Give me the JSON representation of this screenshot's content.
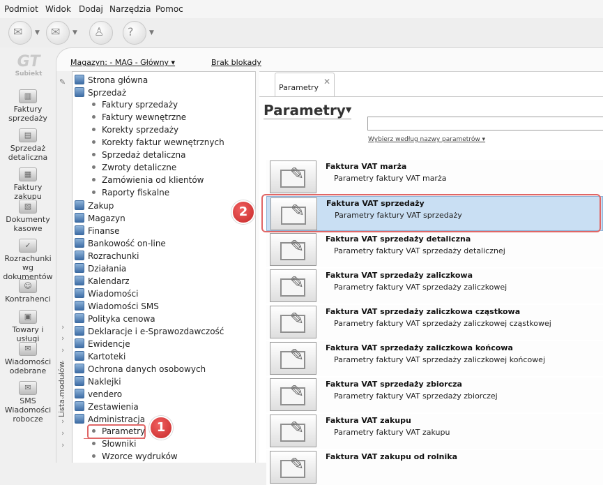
{
  "menu": [
    "Podmiot",
    "Widok",
    "Dodaj",
    "Narzędzia",
    "Pomoc"
  ],
  "toolbar": {
    "icons": [
      "send-icon",
      "mail-icon",
      "stamp-icon",
      "help-icon"
    ]
  },
  "leftnav": {
    "logo_text": "Subiekt",
    "items": [
      {
        "label": "Faktury sprzedaży",
        "icon": "coins-icon"
      },
      {
        "label": "Sprzedaż detaliczna",
        "icon": "bag-icon"
      },
      {
        "label": "Faktury zakupu",
        "icon": "documents-icon"
      },
      {
        "label": "Dokumenty kasowe",
        "icon": "cash-icon"
      },
      {
        "label": "Rozrachunki wg dokumentów",
        "icon": "check-icon"
      },
      {
        "label": "Kontrahenci",
        "icon": "person-icon"
      },
      {
        "label": "Towary i usługi",
        "icon": "box-icon"
      },
      {
        "label": "Wiadomości odebrane",
        "icon": "inbox-icon"
      },
      {
        "label": "SMS Wiadomości robocze",
        "icon": "sms-icon"
      }
    ]
  },
  "header": {
    "magazyn": "Magazyn: - MAG - Główny ▾",
    "blokada": "Brak blokady"
  },
  "module_strip_label": "Lista modułów",
  "tree": {
    "items": [
      {
        "label": "Strona główna",
        "level": 0
      },
      {
        "label": "Sprzedaż",
        "level": 0
      },
      {
        "label": "Faktury sprzedaży",
        "level": 1
      },
      {
        "label": "Faktury wewnętrzne",
        "level": 1
      },
      {
        "label": "Korekty sprzedaży",
        "level": 1
      },
      {
        "label": "Korekty faktur wewnętrznych",
        "level": 1
      },
      {
        "label": "Sprzedaż detaliczna",
        "level": 1
      },
      {
        "label": "Zwroty detaliczne",
        "level": 1
      },
      {
        "label": "Zamówienia od klientów",
        "level": 1
      },
      {
        "label": "Raporty fiskalne",
        "level": 1
      },
      {
        "label": "Zakup",
        "level": 0
      },
      {
        "label": "Magazyn",
        "level": 0
      },
      {
        "label": "Finanse",
        "level": 0
      },
      {
        "label": "Bankowość on-line",
        "level": 0
      },
      {
        "label": "Rozrachunki",
        "level": 0
      },
      {
        "label": "Działania",
        "level": 0
      },
      {
        "label": "Kalendarz",
        "level": 0
      },
      {
        "label": "Wiadomości",
        "level": 0
      },
      {
        "label": "Wiadomości SMS",
        "level": 0
      },
      {
        "label": "Polityka cenowa",
        "level": 0
      },
      {
        "label": "Deklaracje i e-Sprawozdawczość",
        "level": 0
      },
      {
        "label": "Ewidencje",
        "level": 0
      },
      {
        "label": "Kartoteki",
        "level": 0
      },
      {
        "label": "Ochrona danych osobowych",
        "level": 0
      },
      {
        "label": "Naklejki",
        "level": 0
      },
      {
        "label": "vendero",
        "level": 0
      },
      {
        "label": "Zestawienia",
        "level": 0
      },
      {
        "label": "Administracja",
        "level": 0
      },
      {
        "label": "Parametry",
        "level": 1,
        "selected": true
      },
      {
        "label": "Słowniki",
        "level": 1
      },
      {
        "label": "Wzorce wydruków",
        "level": 1
      }
    ]
  },
  "tab": {
    "label": "Parametry",
    "close": "✕"
  },
  "page": {
    "title": "Parametry",
    "search_value": "",
    "search_hint": "Wybierz według nazwy parametrów ▾"
  },
  "params": [
    {
      "title": "Faktura VAT marża",
      "desc": "Parametry faktury VAT marża"
    },
    {
      "title": "Faktura VAT sprzedaży",
      "desc": "Parametry faktury VAT sprzedaży",
      "highlighted": true
    },
    {
      "title": "Faktura VAT sprzedaży detaliczna",
      "desc": "Parametry faktury VAT sprzedaży detalicznej"
    },
    {
      "title": "Faktura VAT sprzedaży zaliczkowa",
      "desc": "Parametry faktury VAT sprzedaży zaliczkowej"
    },
    {
      "title": "Faktura VAT sprzedaży zaliczkowa cząstkowa",
      "desc": "Parametry faktury VAT sprzedaży zaliczkowej cząstkowej"
    },
    {
      "title": "Faktura VAT sprzedaży zaliczkowa końcowa",
      "desc": "Parametry faktury VAT sprzedaży zaliczkowej końcowej"
    },
    {
      "title": "Faktura VAT sprzedaży zbiorcza",
      "desc": "Parametry faktury VAT sprzedaży zbiorczej"
    },
    {
      "title": "Faktura VAT zakupu",
      "desc": "Parametry faktury VAT zakupu"
    },
    {
      "title": "Faktura VAT zakupu od rolnika",
      "desc": ""
    }
  ],
  "callouts": [
    {
      "number": "1"
    },
    {
      "number": "2"
    }
  ],
  "colors": {
    "highlight_row": "#c9dff3",
    "callout_red": "#e06666",
    "badge_red": "#c62828"
  }
}
